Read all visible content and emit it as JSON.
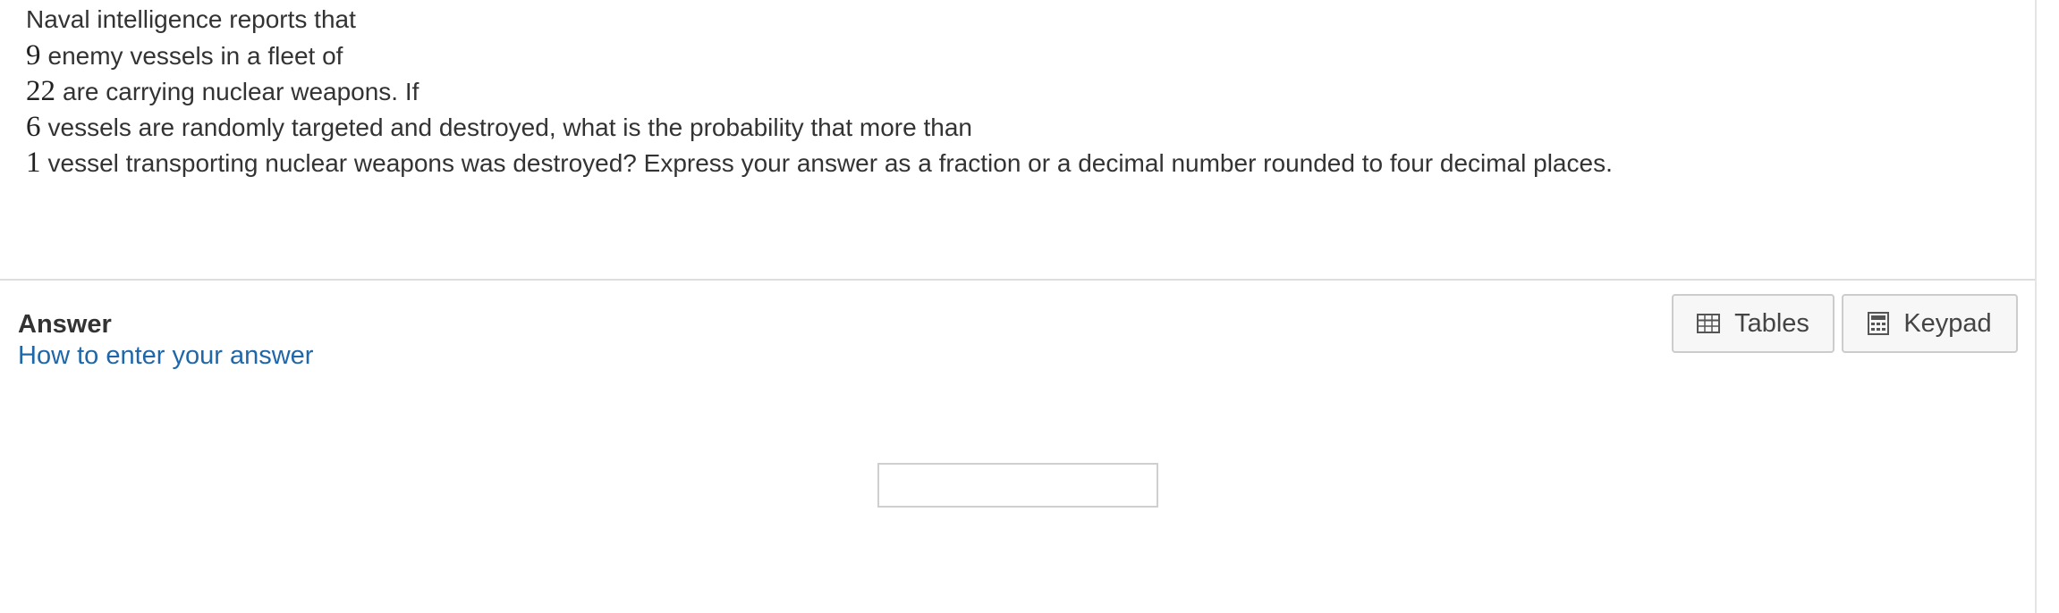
{
  "question": {
    "lines": [
      {
        "num": "",
        "text": "Naval intelligence reports that"
      },
      {
        "num": "9",
        "text": "enemy vessels in a fleet of"
      },
      {
        "num": "22",
        "text": "are carrying nuclear weapons. If"
      },
      {
        "num": "6",
        "text": "vessels are randomly targeted and destroyed, what is the probability that more than"
      },
      {
        "num": "1",
        "text": "vessel transporting nuclear weapons was destroyed? Express your answer as a fraction or a decimal number rounded to four decimal places."
      }
    ]
  },
  "answer": {
    "heading": "Answer",
    "help_link": "How to enter your answer",
    "input_value": ""
  },
  "tools": {
    "tables_label": "Tables",
    "tables_icon": "table-icon",
    "keypad_label": "Keypad",
    "keypad_icon": "calculator-icon"
  },
  "colors": {
    "link": "#1f67a8",
    "text": "#333333",
    "divider": "#dddddd"
  }
}
